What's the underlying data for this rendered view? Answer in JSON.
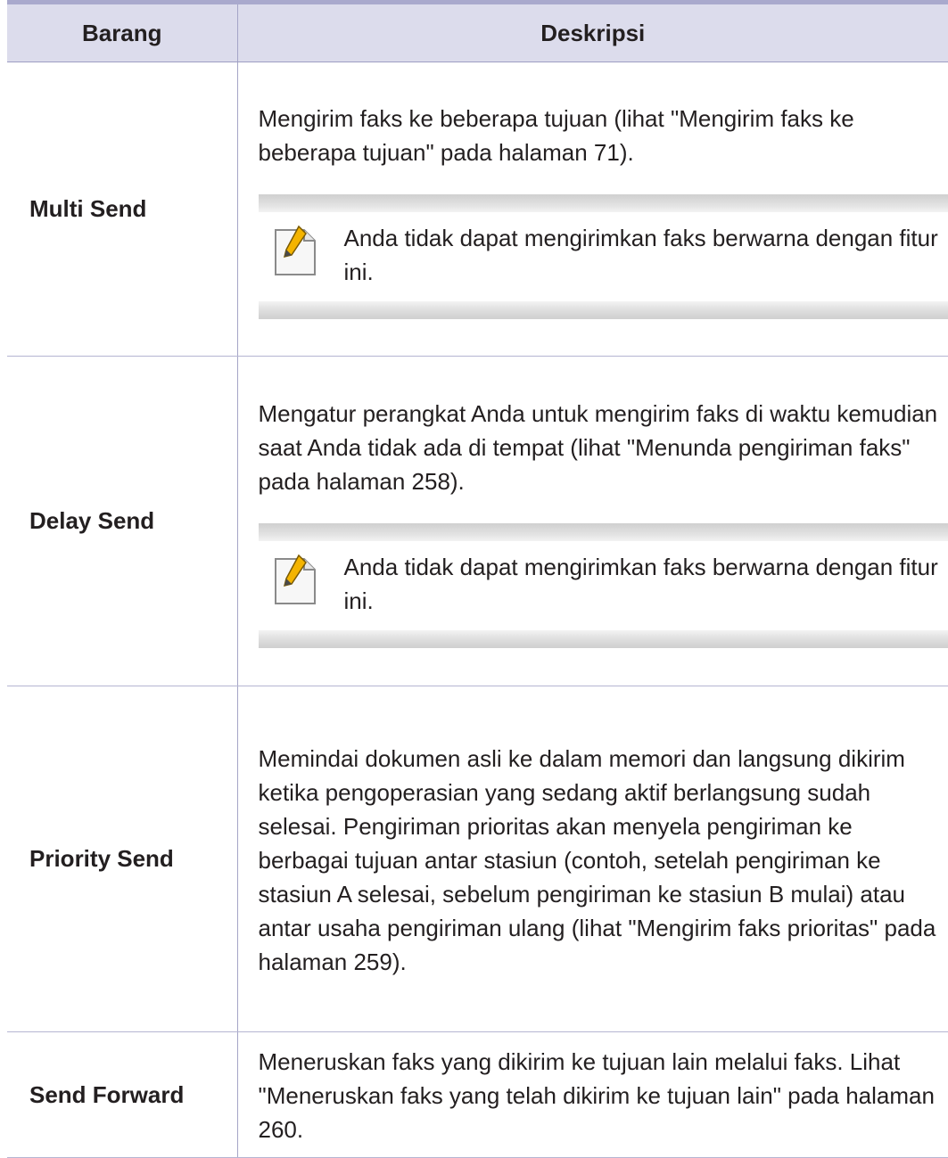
{
  "table": {
    "header": {
      "col_item": "Barang",
      "col_desc": "Deskripsi"
    },
    "rows": [
      {
        "item": "Multi Send",
        "description": "Mengirim faks ke beberapa tujuan (lihat \"Mengirim faks ke beberapa tujuan\" pada halaman 71).",
        "note": "Anda tidak dapat mengirimkan faks berwarna dengan fitur ini."
      },
      {
        "item": "Delay Send",
        "description": "Mengatur perangkat Anda untuk mengirim faks di waktu kemudian saat Anda tidak ada di tempat (lihat \"Menunda pengiriman faks\" pada halaman 258).",
        "note": "Anda tidak dapat mengirimkan faks berwarna dengan fitur ini."
      },
      {
        "item": "Priority Send",
        "description": "Memindai dokumen asli ke dalam memori dan langsung dikirim ketika pengoperasian yang sedang aktif berlangsung sudah selesai. Pengiriman prioritas akan menyela pengiriman ke berbagai tujuan antar stasiun (contoh, setelah pengiriman ke stasiun A selesai, sebelum pengiriman ke stasiun B mulai) atau antar usaha pengiriman ulang (lihat \"Mengirim faks prioritas\" pada halaman 259)."
      },
      {
        "item": "Send Forward",
        "description": "Meneruskan faks yang dikirim ke tujuan lain melalui faks. Lihat \"Meneruskan faks yang telah dikirim ke tujuan lain\" pada halaman 260."
      }
    ]
  },
  "icons": {
    "note": "note-pencil-icon"
  },
  "colors": {
    "header_bg": "#dcdcec",
    "header_rule": "#a9a9cd",
    "row_rule": "#b5b5d2",
    "text": "#231f20",
    "icon_pencil": "#f4b400"
  }
}
